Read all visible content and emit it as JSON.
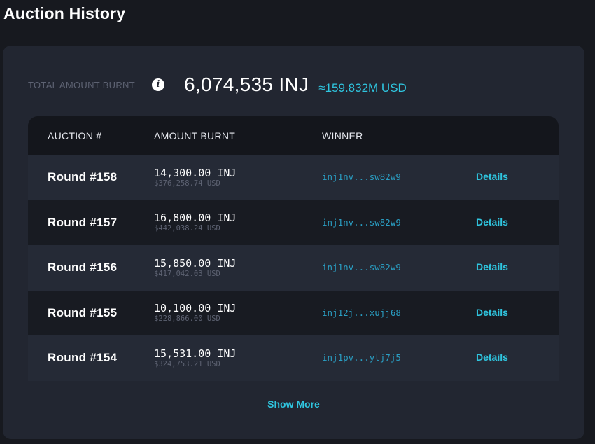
{
  "page": {
    "title": "Auction History"
  },
  "summary": {
    "label": "TOTAL AMOUNT BURNT",
    "info_icon": "info-icon",
    "amount": "6,074,535 INJ",
    "usd": "≈159.832M USD"
  },
  "table": {
    "headers": {
      "auction": "AUCTION #",
      "amount": "AMOUNT BURNT",
      "winner": "WINNER"
    },
    "rows": [
      {
        "round": "Round #158",
        "amount": "14,300.00 INJ",
        "usd": "$376,258.74 USD",
        "winner": "inj1nv...sw82w9",
        "details": "Details"
      },
      {
        "round": "Round #157",
        "amount": "16,800.00 INJ",
        "usd": "$442,038.24 USD",
        "winner": "inj1nv...sw82w9",
        "details": "Details"
      },
      {
        "round": "Round #156",
        "amount": "15,850.00 INJ",
        "usd": "$417,042.03 USD",
        "winner": "inj1nv...sw82w9",
        "details": "Details"
      },
      {
        "round": "Round #155",
        "amount": "10,100.00 INJ",
        "usd": "$228,866.00 USD",
        "winner": "inj12j...xujj68",
        "details": "Details"
      },
      {
        "round": "Round #154",
        "amount": "15,531.00 INJ",
        "usd": "$324,753.21 USD",
        "winner": "inj1pv...ytj7j5",
        "details": "Details"
      }
    ]
  },
  "footer": {
    "show_more": "Show More"
  },
  "colors": {
    "accent": "#2fc6e0",
    "link": "#2a9fc4",
    "panel": "#222631",
    "background": "#17191f"
  }
}
